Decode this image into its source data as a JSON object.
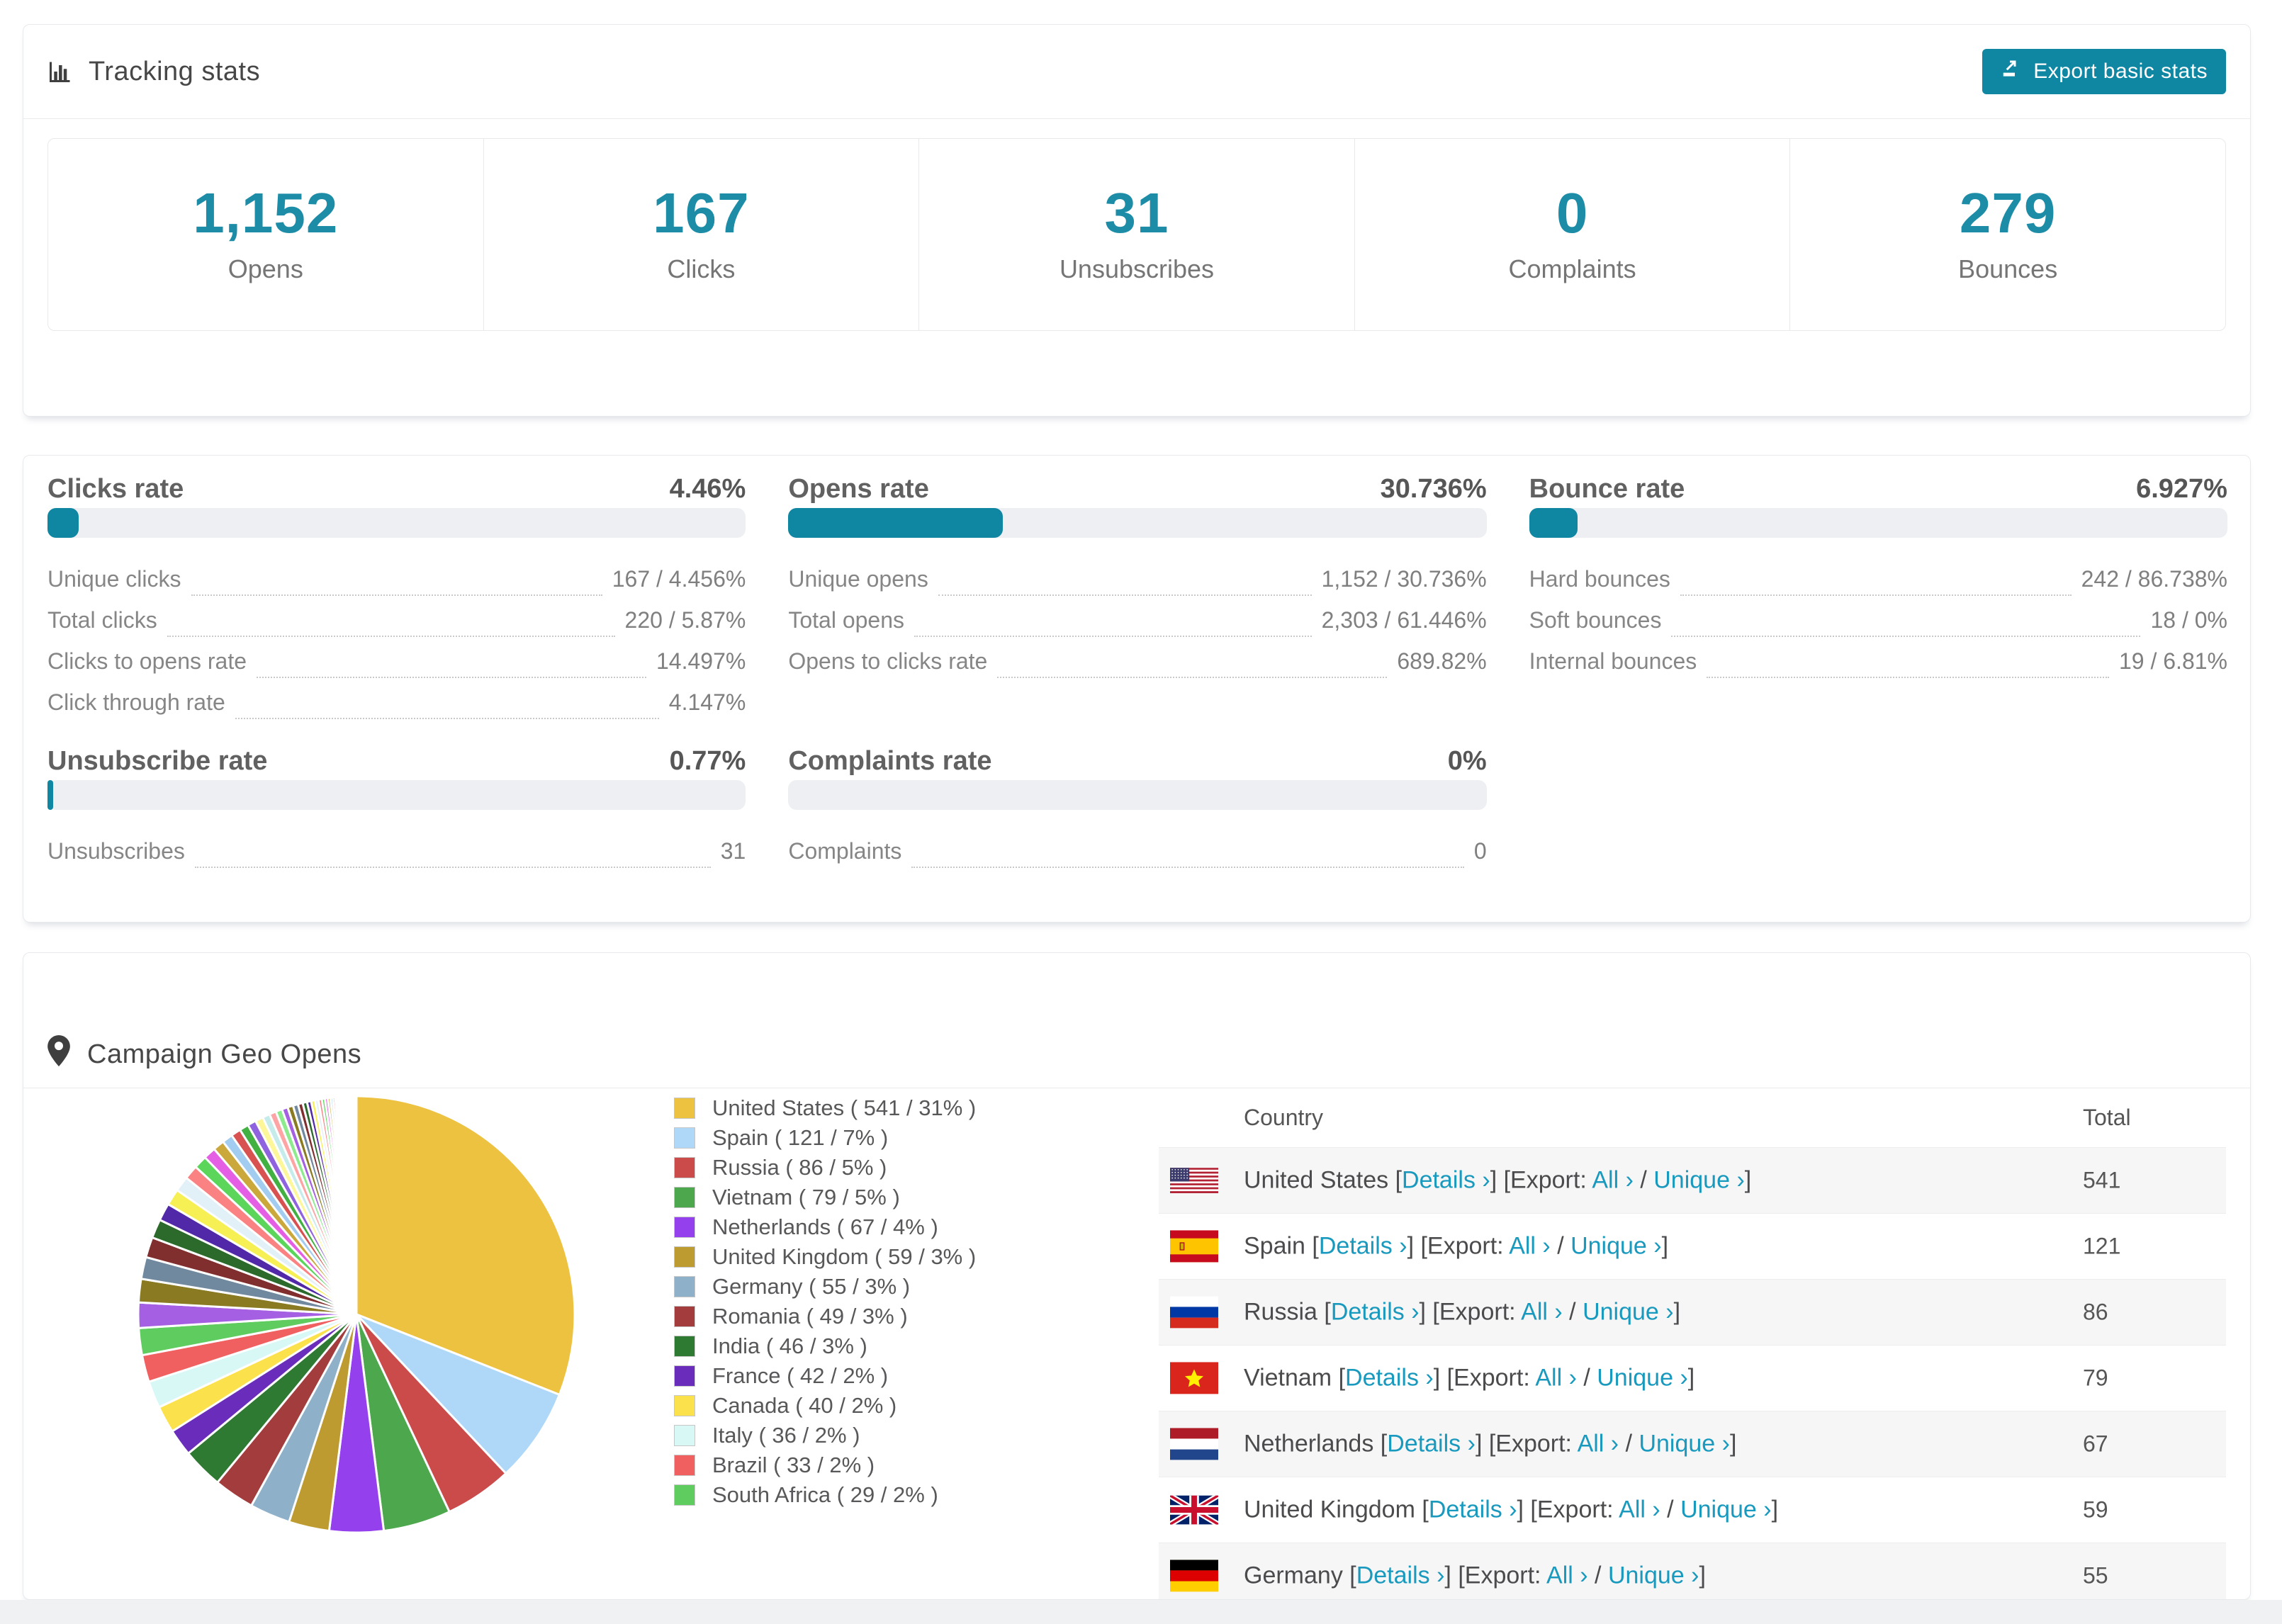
{
  "colors": {
    "accent": "#0f87a2",
    "number": "#1d8ca7",
    "link": "#1899bd",
    "bar_bg": "#edeff2"
  },
  "tracking": {
    "title": "Tracking stats",
    "export_button": "Export basic stats",
    "stats": [
      {
        "value": "1,152",
        "label": "Opens"
      },
      {
        "value": "167",
        "label": "Clicks"
      },
      {
        "value": "31",
        "label": "Unsubscribes"
      },
      {
        "value": "0",
        "label": "Complaints"
      },
      {
        "value": "279",
        "label": "Bounces"
      }
    ]
  },
  "rates": [
    {
      "title": "Clicks rate",
      "value": "4.46%",
      "bar_pct": 4.46,
      "rows": [
        {
          "label": "Unique clicks",
          "value": "167 / 4.456%"
        },
        {
          "label": "Total clicks",
          "value": "220 / 5.87%"
        },
        {
          "label": "Clicks to opens rate",
          "value": "14.497%"
        },
        {
          "label": "Click through rate",
          "value": "4.147%"
        }
      ]
    },
    {
      "title": "Opens rate",
      "value": "30.736%",
      "bar_pct": 30.736,
      "rows": [
        {
          "label": "Unique opens",
          "value": "1,152 / 30.736%"
        },
        {
          "label": "Total opens",
          "value": "2,303 / 61.446%"
        },
        {
          "label": "Opens to clicks rate",
          "value": "689.82%"
        }
      ]
    },
    {
      "title": "Bounce rate",
      "value": "6.927%",
      "bar_pct": 6.927,
      "rows": [
        {
          "label": "Hard bounces",
          "value": "242 / 86.738%"
        },
        {
          "label": "Soft bounces",
          "value": "18 / 0%"
        },
        {
          "label": "Internal bounces",
          "value": "19 / 6.81%"
        }
      ]
    },
    {
      "title": "Unsubscribe rate",
      "value": "0.77%",
      "bar_pct": 0.77,
      "rows": [
        {
          "label": "Unsubscribes",
          "value": "31"
        }
      ]
    },
    {
      "title": "Complaints rate",
      "value": "0%",
      "bar_pct": 0,
      "rows": [
        {
          "label": "Complaints",
          "value": "0"
        }
      ]
    }
  ],
  "geo": {
    "title": "Campaign Geo Opens",
    "table": {
      "headers": [
        "Country",
        "Total"
      ],
      "links": {
        "open": "[",
        "details": "Details ›",
        "close": "]",
        "export_open": "[Export:",
        "all": "All ›",
        "slash": "/",
        "unique": "Unique ›",
        "export_close": "]"
      },
      "rows": [
        {
          "country": "United States",
          "flag": "us",
          "total": "541"
        },
        {
          "country": "Spain",
          "flag": "es",
          "total": "121"
        },
        {
          "country": "Russia",
          "flag": "ru",
          "total": "86"
        },
        {
          "country": "Vietnam",
          "flag": "vn",
          "total": "79"
        },
        {
          "country": "Netherlands",
          "flag": "nl",
          "total": "67"
        },
        {
          "country": "United Kingdom",
          "flag": "gb",
          "total": "59"
        },
        {
          "country": "Germany",
          "flag": "de",
          "total": "55"
        }
      ]
    }
  },
  "chart_data": {
    "type": "pie",
    "title": "Campaign Geo Opens",
    "legend_position": "right",
    "start_angle_deg": -90,
    "direction": "clockwise",
    "slices": [
      {
        "name": "United States",
        "count": 541,
        "pct": 31,
        "color": "#edc240"
      },
      {
        "name": "Spain",
        "count": 121,
        "pct": 7,
        "color": "#afd8f8"
      },
      {
        "name": "Russia",
        "count": 86,
        "pct": 5,
        "color": "#cb4b4b"
      },
      {
        "name": "Vietnam",
        "count": 79,
        "pct": 5,
        "color": "#4da74d"
      },
      {
        "name": "Netherlands",
        "count": 67,
        "pct": 4,
        "color": "#9440ed"
      },
      {
        "name": "United Kingdom",
        "count": 59,
        "pct": 3,
        "color": "#be9b30"
      },
      {
        "name": "Germany",
        "count": 55,
        "pct": 3,
        "color": "#8fb0c9"
      },
      {
        "name": "Romania",
        "count": 49,
        "pct": 3,
        "color": "#a33d3d"
      },
      {
        "name": "India",
        "count": 46,
        "pct": 3,
        "color": "#2f7a33"
      },
      {
        "name": "France",
        "count": 42,
        "pct": 2,
        "color": "#6a2dbb"
      },
      {
        "name": "Canada",
        "count": 40,
        "pct": 2,
        "color": "#fbe24c"
      },
      {
        "name": "Italy",
        "count": 36,
        "pct": 2,
        "color": "#d8f8f6"
      },
      {
        "name": "Brazil",
        "count": 33,
        "pct": 2,
        "color": "#f16060"
      },
      {
        "name": "South Africa",
        "count": 29,
        "pct": 2,
        "color": "#5fcc5f"
      }
    ],
    "other": {
      "note": "many small unlabeled country slices filling the remainder",
      "total_pct": 26,
      "count": 50,
      "start": 1.5,
      "ratio": 0.93,
      "palette": [
        "#a55fe3",
        "#8a7a22",
        "#70899e",
        "#802e2e",
        "#2c6a2c",
        "#5128a8",
        "#f7f055",
        "#e2f0f8",
        "#fb8282",
        "#5bd65b",
        "#e45fe4",
        "#caa83c",
        "#a2cdf0",
        "#d95252",
        "#42b142",
        "#8f62df",
        "#fdf79a",
        "#c6ebeb",
        "#ffa4a4",
        "#8deb8d"
      ]
    }
  }
}
